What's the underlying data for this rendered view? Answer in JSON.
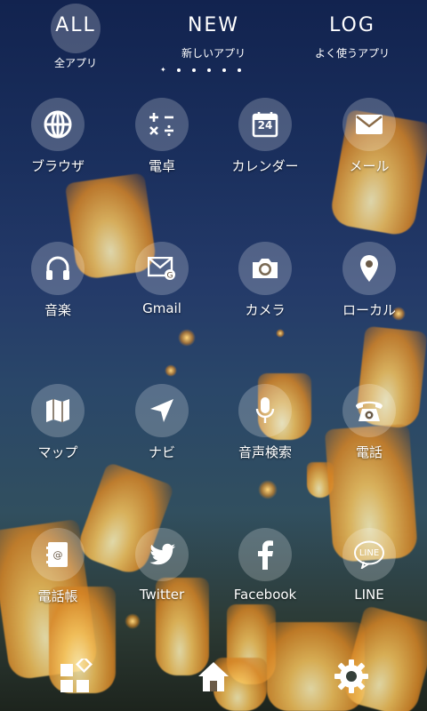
{
  "tabs": [
    {
      "label": "ALL",
      "sub": "全アプリ"
    },
    {
      "label": "NEW",
      "sub": "新しいアプリ"
    },
    {
      "label": "LOG",
      "sub": "よく使うアプリ"
    }
  ],
  "apps": [
    {
      "label": "ブラウザ",
      "icon": "globe-icon"
    },
    {
      "label": "電卓",
      "icon": "calculator-icon"
    },
    {
      "label": "カレンダー",
      "icon": "calendar-icon",
      "calendar_day": "24"
    },
    {
      "label": "メール",
      "icon": "mail-icon"
    },
    {
      "label": "音楽",
      "icon": "headphones-icon"
    },
    {
      "label": "Gmail",
      "icon": "gmail-icon"
    },
    {
      "label": "カメラ",
      "icon": "camera-icon"
    },
    {
      "label": "ローカル",
      "icon": "map-pin-icon"
    },
    {
      "label": "マップ",
      "icon": "map-icon"
    },
    {
      "label": "ナビ",
      "icon": "navigation-arrow-icon"
    },
    {
      "label": "音声検索",
      "icon": "microphone-icon"
    },
    {
      "label": "電話",
      "icon": "phone-icon"
    },
    {
      "label": "電話帳",
      "icon": "contacts-book-icon"
    },
    {
      "label": "Twitter",
      "icon": "twitter-icon"
    },
    {
      "label": "Facebook",
      "icon": "facebook-icon"
    },
    {
      "label": "LINE",
      "icon": "line-icon",
      "badge": "LINE"
    }
  ],
  "dock": [
    {
      "icon": "app-drawer-icon"
    },
    {
      "icon": "home-icon"
    },
    {
      "icon": "settings-gear-icon"
    }
  ]
}
